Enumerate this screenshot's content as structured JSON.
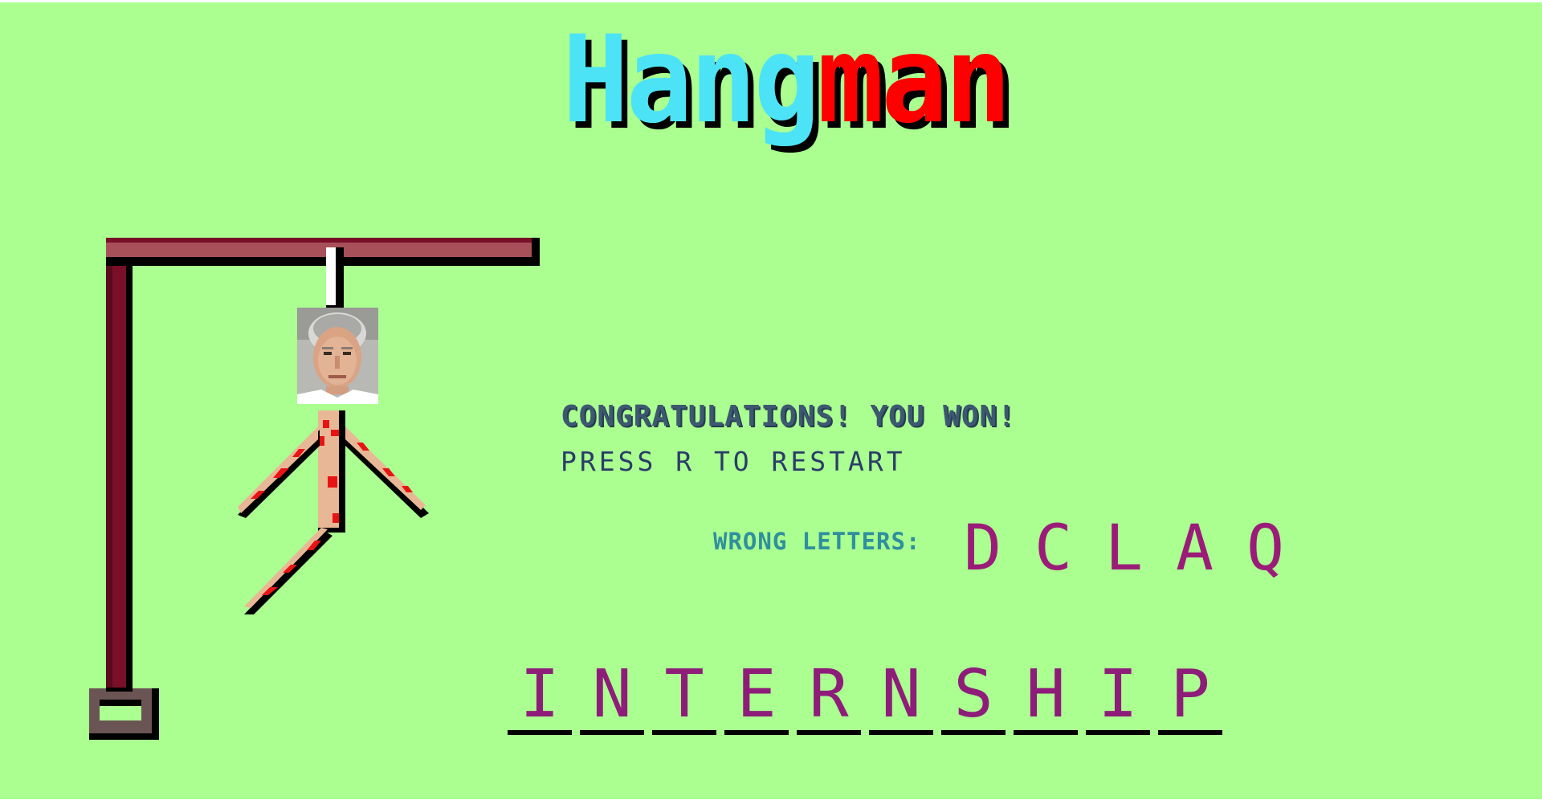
{
  "title": {
    "part1": "Hang",
    "part2": "man"
  },
  "message": {
    "result": "CONGRATULATIONS! YOU WON!",
    "restart_hint": "PRESS R TO RESTART"
  },
  "wrong_letters": {
    "label": "WRONG LETTERS:",
    "letters": [
      "D",
      "C",
      "L",
      "A",
      "Q"
    ]
  },
  "word": {
    "letters": [
      "I",
      "N",
      "T",
      "E",
      "R",
      "N",
      "S",
      "H",
      "I",
      "P"
    ]
  },
  "colors": {
    "background": "#aaff90",
    "title_cyan": "#4de3f6",
    "title_red": "#ff0000",
    "letters": "#9b1c78",
    "gallows": "#7a0f2a"
  },
  "icons": {
    "face": "face-photo-icon"
  }
}
